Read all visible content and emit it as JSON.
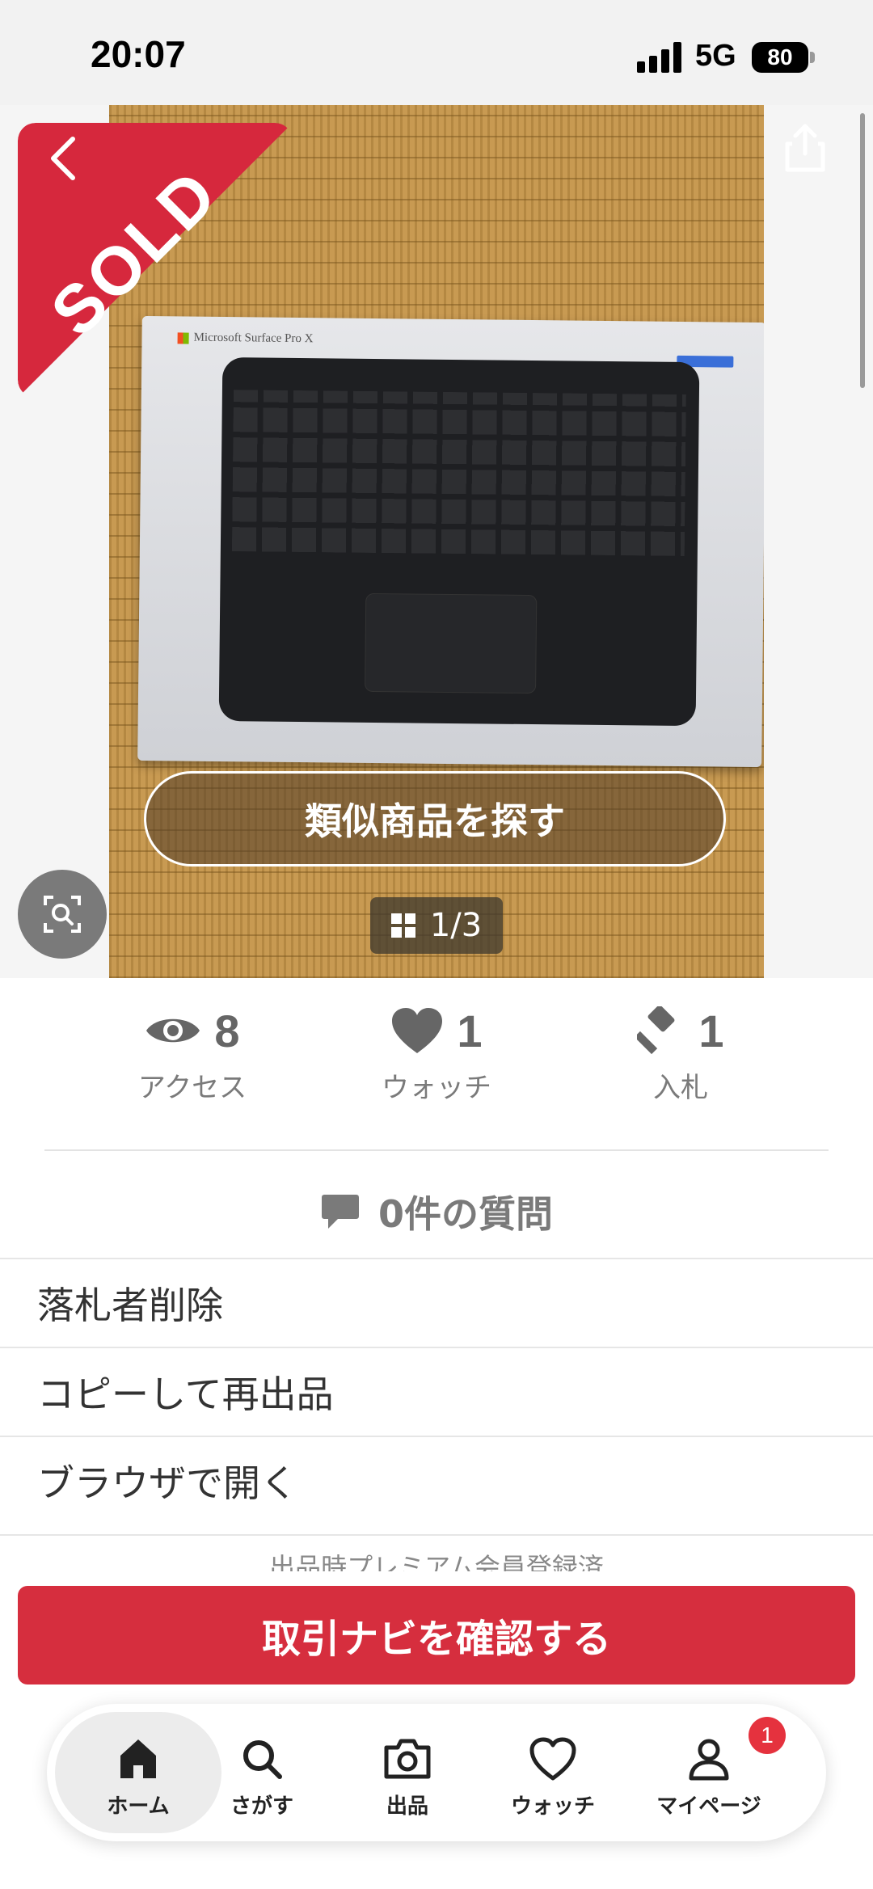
{
  "status_bar": {
    "time": "20:07",
    "network": "5G",
    "battery": "80"
  },
  "image": {
    "sold_label": "SOLD",
    "product_brand": "Microsoft Surface Pro X",
    "find_similar_label": "類似商品を探す",
    "page_indicator": "1/3"
  },
  "stats": {
    "access_value": "8",
    "access_label": "アクセス",
    "watch_value": "1",
    "watch_label": "ウォッチ",
    "bid_value": "1",
    "bid_label": "入札"
  },
  "questions_label": "0件の質問",
  "menu": {
    "items": [
      {
        "label": "落札者削除"
      },
      {
        "label": "コピーして再出品"
      },
      {
        "label": "ブラウザで開く"
      }
    ]
  },
  "premium_note": "出品時プレミアム会員登録済",
  "cta_label": "取引ナビを確認する",
  "tabbar": {
    "items": [
      {
        "label": "ホーム",
        "icon": "home-icon"
      },
      {
        "label": "さがす",
        "icon": "search-icon"
      },
      {
        "label": "出品",
        "icon": "camera-icon"
      },
      {
        "label": "ウォッチ",
        "icon": "heart-icon"
      },
      {
        "label": "マイページ",
        "icon": "person-icon"
      }
    ],
    "notification_count": "1"
  },
  "colors": {
    "accent_red": "#d62e3e",
    "sold_red": "#d6283d"
  }
}
